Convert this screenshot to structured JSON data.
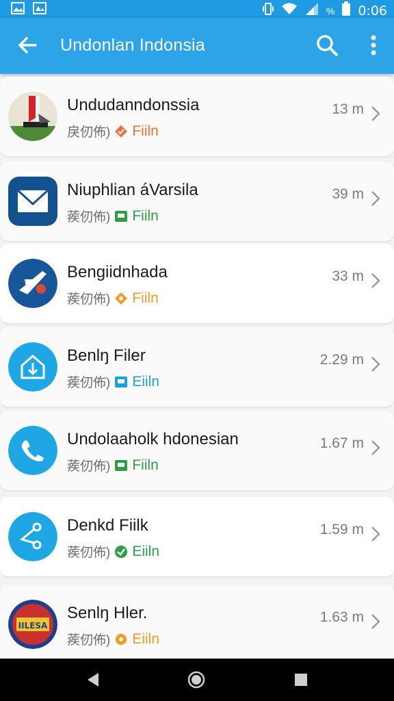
{
  "status_bar": {
    "time": "0:06",
    "icons": [
      "gallery-icon",
      "image-icon",
      "vibrate-icon",
      "wifi-icon",
      "signal-icon",
      "battery-icon"
    ],
    "signal_text": "%"
  },
  "app_bar": {
    "title": "Undonlan Indonsia",
    "color": "#2da3e8",
    "icons": [
      "back-arrow-icon",
      "search-icon",
      "more-vert-icon"
    ]
  },
  "items": [
    {
      "name": "Undudanndonssia",
      "sub_label": "戾仞佈)",
      "tag": "Fiiln",
      "tag_color": "#e8703a",
      "tag_icon": "diamond-tag-icon",
      "size": "13 m",
      "avatar_icon": "flag-photo-icon"
    },
    {
      "name": "Niuphlian áVarsila",
      "sub_label": "蒺仞佈)",
      "tag": "Fiiln",
      "tag_color": "#2e9e44",
      "tag_icon": "square-tag-icon",
      "size": "39 m",
      "avatar_icon": "mail-icon"
    },
    {
      "name": "Bengiidnhada",
      "sub_label": "蒺仞佈)",
      "tag": "Fiiln",
      "tag_color": "#f39a23",
      "tag_icon": "diamond-tag-icon",
      "size": "33 m",
      "avatar_icon": "rocket-icon"
    },
    {
      "name": "Benlŋ Filer",
      "sub_label": "蒺仞佈)",
      "tag": "Eiiln",
      "tag_color": "#1aa2d8",
      "tag_icon": "square-tag-icon",
      "size": "2.29 m",
      "avatar_icon": "home-download-icon"
    },
    {
      "name": "Undolaaholk hdonesian",
      "sub_label": "蒺仞佈)",
      "tag": "Fiiln",
      "tag_color": "#2e9e44",
      "tag_icon": "square-tag-icon",
      "size": "1.67 m",
      "avatar_icon": "phone-icon"
    },
    {
      "name": "Denkd Fiilk",
      "sub_label": "蒺仞佈)",
      "tag": "Eiiln",
      "tag_color": "#2e9e44",
      "tag_icon": "check-tag-icon",
      "size": "1.59 m",
      "avatar_icon": "share-icon"
    },
    {
      "name": "Senlŋ Hler.",
      "sub_label": "蒺仞佈)",
      "tag": "Eiiln",
      "tag_color": "#f39a23",
      "tag_icon": "gear-tag-icon",
      "size": "1.63 m",
      "avatar_icon": "emblem-icon",
      "avatar_text": "IILESA"
    }
  ],
  "nav_bar": {
    "icons": [
      "nav-back-icon",
      "nav-home-icon",
      "nav-recents-icon"
    ]
  }
}
